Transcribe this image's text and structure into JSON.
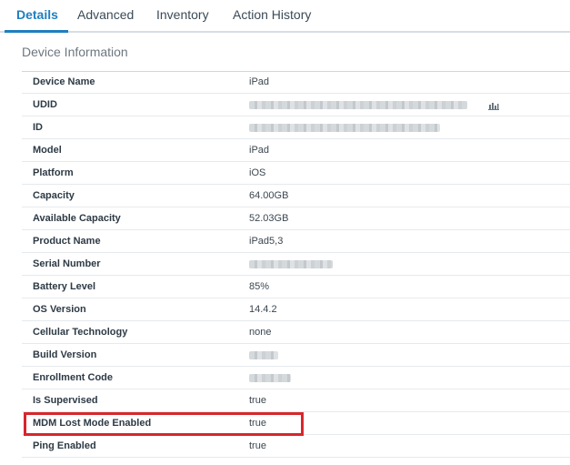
{
  "tabs": [
    {
      "label": "Details",
      "active": true
    },
    {
      "label": "Advanced",
      "active": false
    },
    {
      "label": "Inventory",
      "active": false
    },
    {
      "label": "Action History",
      "active": false
    }
  ],
  "panel": {
    "title": "Device Information"
  },
  "rows": [
    {
      "label": "Device Name",
      "value": "iPad"
    },
    {
      "label": "UDID",
      "value": "",
      "redacted": true,
      "icon": "bar-chart-icon"
    },
    {
      "label": "ID",
      "value": "",
      "redacted": true
    },
    {
      "label": "Model",
      "value": "iPad"
    },
    {
      "label": "Platform",
      "value": "iOS"
    },
    {
      "label": "Capacity",
      "value": "64.00GB"
    },
    {
      "label": "Available Capacity",
      "value": "52.03GB"
    },
    {
      "label": "Product Name",
      "value": "iPad5,3"
    },
    {
      "label": "Serial Number",
      "value": "",
      "redacted": true
    },
    {
      "label": "Battery Level",
      "value": "85%"
    },
    {
      "label": "OS Version",
      "value": "14.4.2"
    },
    {
      "label": "Cellular Technology",
      "value": "none"
    },
    {
      "label": "Build Version",
      "value": "",
      "redacted": true
    },
    {
      "label": "Enrollment Code",
      "value": "",
      "redacted": true
    },
    {
      "label": "Is Supervised",
      "value": "true"
    },
    {
      "label": "MDM Lost Mode Enabled",
      "value": "true",
      "highlighted": true
    },
    {
      "label": "Ping Enabled",
      "value": "true"
    }
  ],
  "colors": {
    "accent": "#1f7fbf",
    "highlight_box": "#d7262c"
  }
}
